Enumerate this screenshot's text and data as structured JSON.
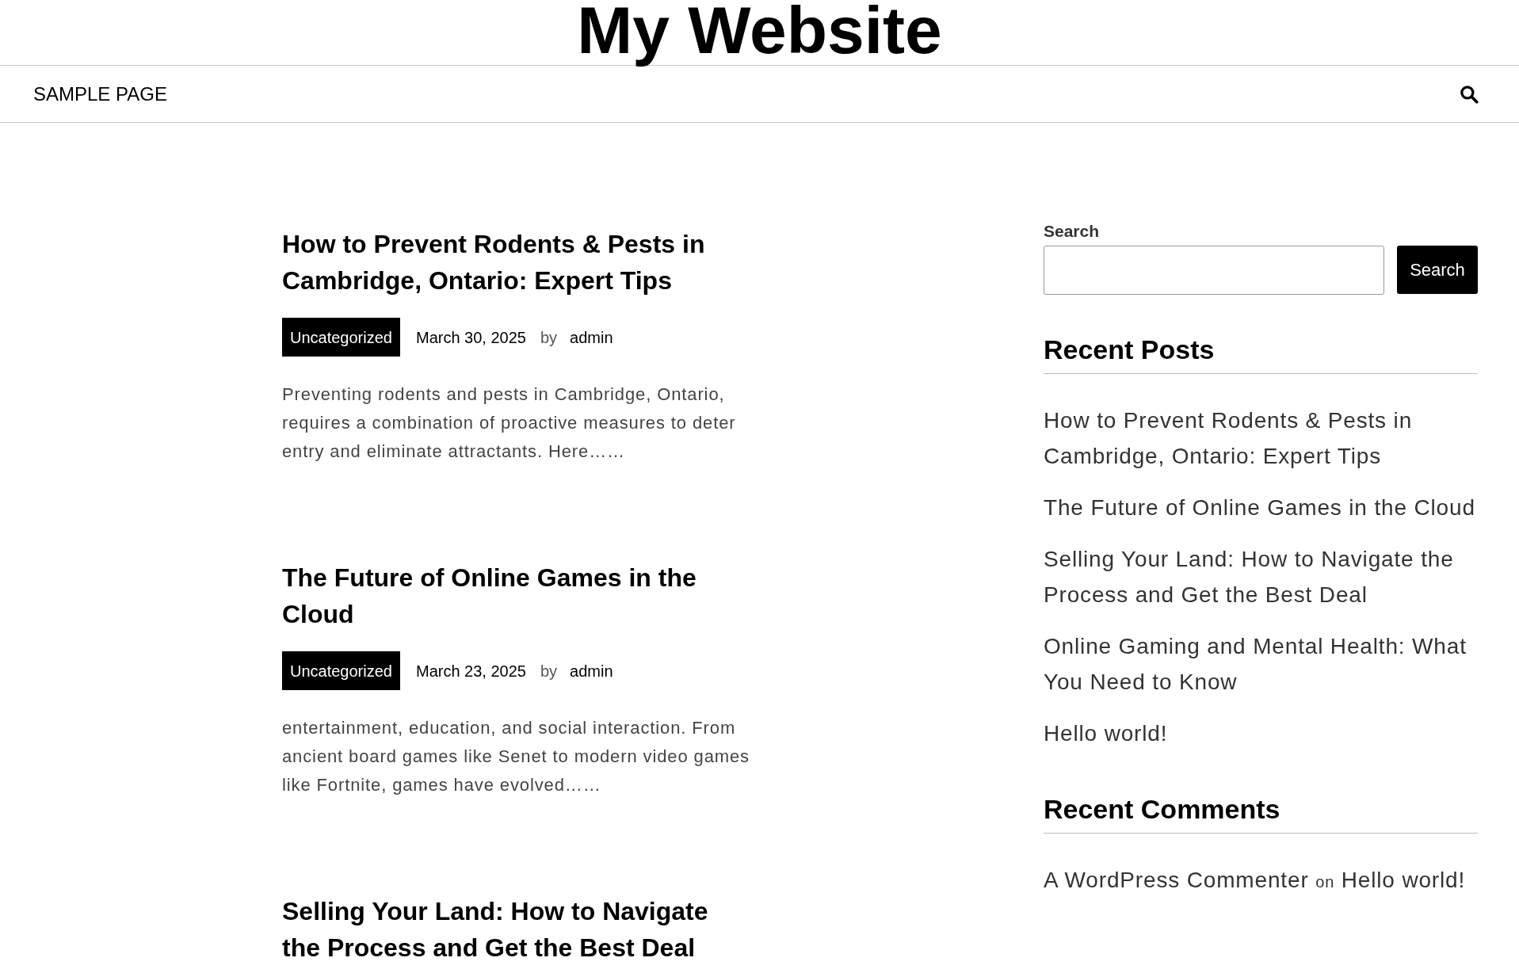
{
  "site_title": "My Website",
  "nav": {
    "items": [
      {
        "label": "SAMPLE PAGE"
      }
    ]
  },
  "posts": [
    {
      "title": "How to Prevent Rodents & Pests in Cambridge, Ontario: Expert Tips",
      "category": "Uncategorized",
      "date": "March 30, 2025",
      "by": "by",
      "author": "admin",
      "excerpt": "Preventing rodents and pests in Cambridge, Ontario, requires a combination of proactive measures to deter entry and eliminate attractants. Here……"
    },
    {
      "title": "The Future of Online Games in the Cloud",
      "category": "Uncategorized",
      "date": "March 23, 2025",
      "by": "by",
      "author": "admin",
      "excerpt": "entertainment, education, and social interaction. From ancient board games like Senet to modern video games like Fortnite, games have evolved……"
    },
    {
      "title": "Selling Your Land: How to Navigate the Process and Get the Best Deal"
    }
  ],
  "sidebar": {
    "search": {
      "label": "Search",
      "button": "Search"
    },
    "recent_posts": {
      "heading": "Recent Posts",
      "items": [
        "How to Prevent Rodents & Pests in Cambridge, Ontario: Expert Tips",
        "The Future of Online Games in the Cloud",
        "Selling Your Land: How to Navigate the Process and Get the Best Deal",
        "Online Gaming and Mental Health: What You Need to Know",
        "Hello world!"
      ]
    },
    "recent_comments": {
      "heading": "Recent Comments",
      "items": [
        {
          "author": "A WordPress Commenter",
          "on": "on",
          "post": "Hello world!"
        }
      ]
    }
  }
}
